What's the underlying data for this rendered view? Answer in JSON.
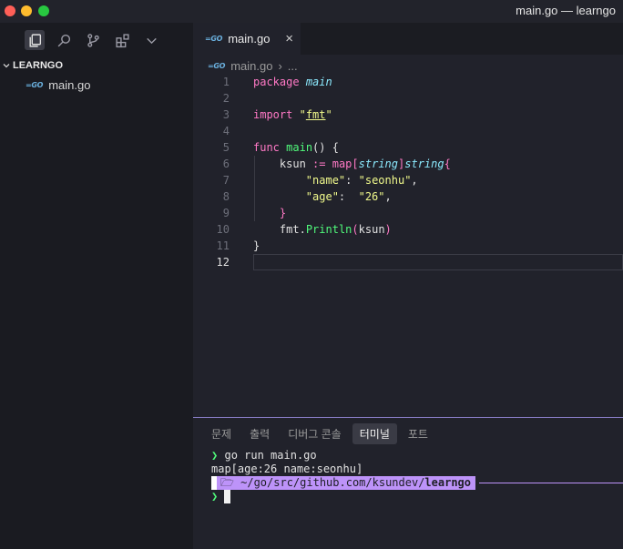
{
  "window": {
    "title": "main.go — learngo"
  },
  "sidebar": {
    "activity_icons": [
      "explorer-icon",
      "search-icon",
      "source-control-icon",
      "extensions-icon",
      "chevron-down-icon"
    ],
    "section_title": "LEARNGO",
    "files": [
      {
        "badge": "GO",
        "name": "main.go"
      }
    ]
  },
  "editor": {
    "tab": {
      "badge": "GO",
      "label": "main.go",
      "close": "×"
    },
    "breadcrumb": {
      "badge": "GO",
      "file": "main.go",
      "sep": "›",
      "more": "..."
    },
    "line_numbers": [
      "1",
      "2",
      "3",
      "4",
      "5",
      "6",
      "7",
      "8",
      "9",
      "10",
      "11",
      "12"
    ],
    "current_line": 12,
    "code": {
      "l1_kw": "package",
      "l1_name": "main",
      "l3_kw": "import",
      "l3_q1": "\"",
      "l3_pkg": "fmt",
      "l3_q2": "\"",
      "l5_kw": "func",
      "l5_name": "main",
      "l5_rest": "() {",
      "l6_var": "ksun",
      "l6_op": ":=",
      "l6_map": "map",
      "l6_lb": "[",
      "l6_t1": "string",
      "l6_rb": "]",
      "l6_t2": "string",
      "l6_brace": "{",
      "l7_key": "\"name\"",
      "l7_colon": ":",
      "l7_val": "\"seonhu\"",
      "l7_comma": ",",
      "l8_key": "\"age\"",
      "l8_colon": ":",
      "l8_val": "\"26\"",
      "l8_comma": ",",
      "l9_close": "}",
      "l10_pkg": "fmt",
      "l10_dot": ".",
      "l10_fn": "Println",
      "l10_lp": "(",
      "l10_arg": "ksun",
      "l10_rp": ")",
      "l11_close": "}"
    }
  },
  "panel": {
    "tabs": [
      "문제",
      "출력",
      "디버그 콘솔",
      "터미널",
      "포트"
    ],
    "active_tab": "터미널",
    "terminal": {
      "prompt_symbol": "❯",
      "command": "go run main.go",
      "output": "map[age:26 name:seonhu]",
      "apple_glyph": "",
      "folder_glyph": "🗁",
      "path_prefix": "~/go/src/github.com/ksundev/",
      "path_bold": "learngo"
    }
  },
  "colors": {
    "accent_purple": "#bd93f9",
    "keyword_pink": "#ff79c6",
    "string_yellow": "#f1fa8c",
    "function_green": "#50fa7b",
    "type_cyan": "#8be9fd"
  }
}
